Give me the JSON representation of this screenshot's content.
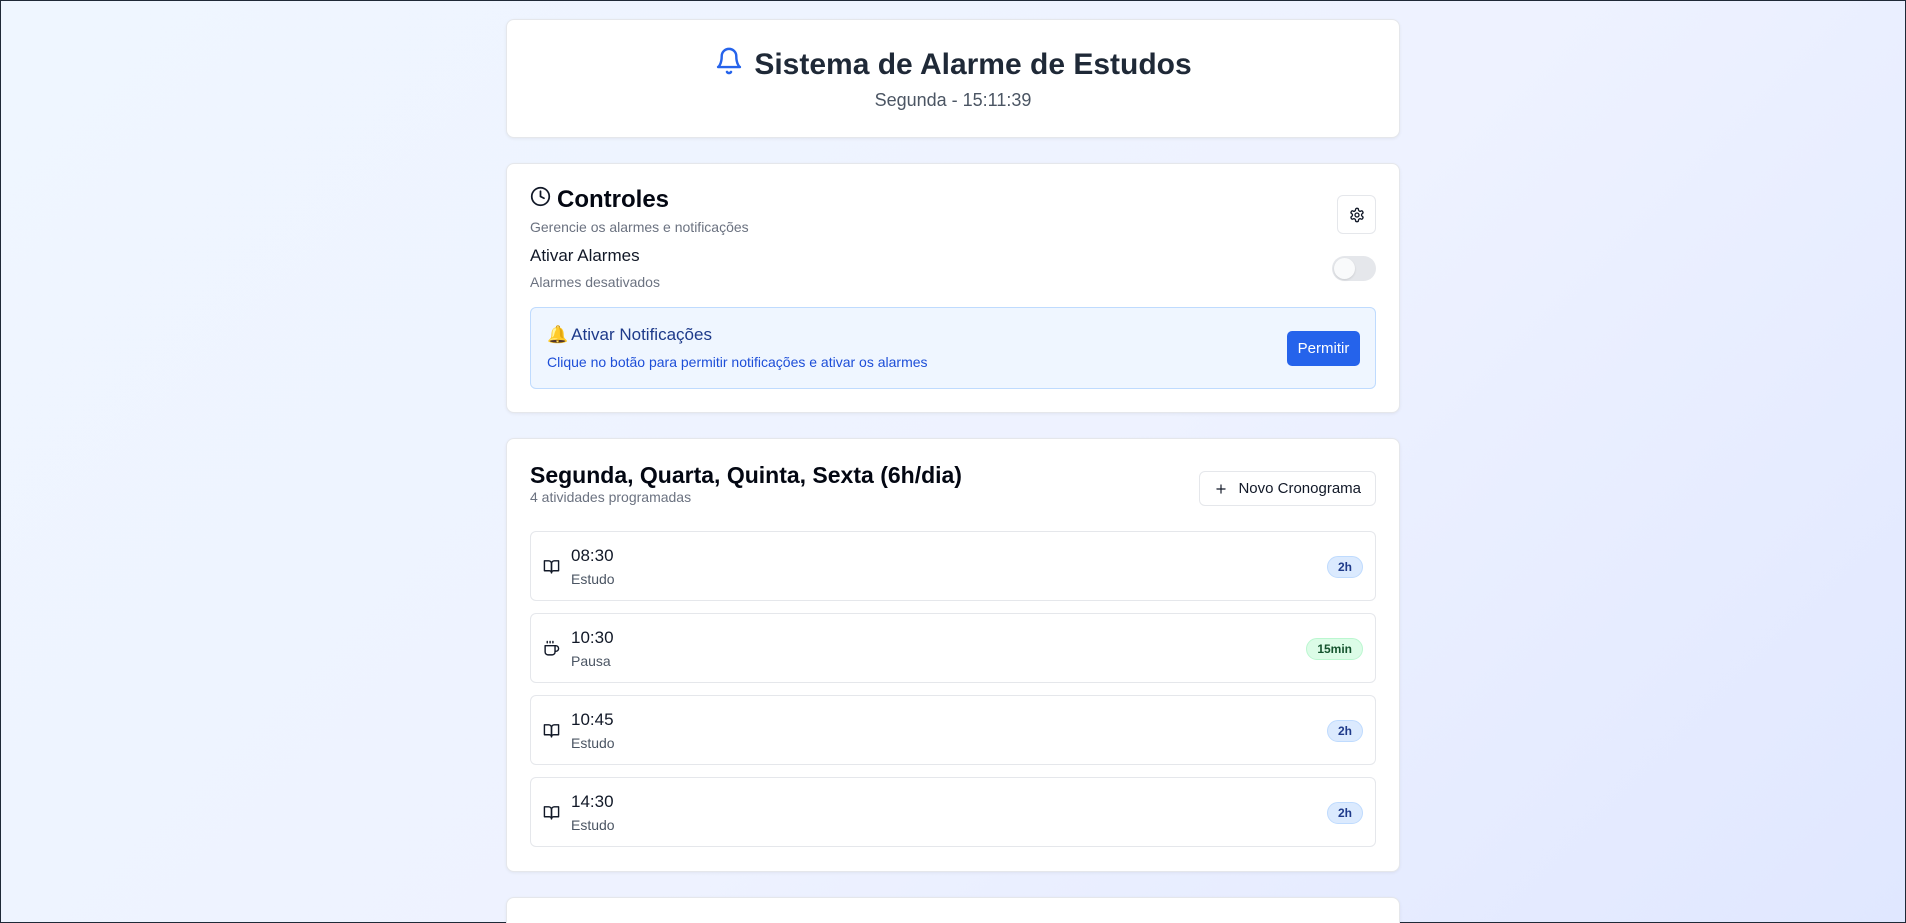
{
  "header": {
    "title": "Sistema de Alarme de Estudos",
    "clock": "Segunda - 15:11:39",
    "icon": "bell-icon",
    "accent_color": "#2563eb"
  },
  "controls": {
    "title": "Controles",
    "subtitle": "Gerencie os alarmes e notificações",
    "settings_icon": "gear-icon",
    "alarm_label": "Ativar Alarmes",
    "alarm_status": "Alarmes desativados",
    "alarm_enabled": false,
    "notifications": {
      "emoji": "🔔",
      "title": "Ativar Notificações",
      "description": "Clique no botão para permitir notificações e ativar os alarmes",
      "button_label": "Permitir"
    }
  },
  "schedule": {
    "title": "Segunda, Quarta, Quinta, Sexta (6h/dia)",
    "count_text": "4 atividades programadas",
    "new_button_label": "Novo Cronograma",
    "activities": [
      {
        "time": "08:30",
        "type": "Estudo",
        "duration": "2h",
        "kind": "study",
        "icon": "book-icon"
      },
      {
        "time": "10:30",
        "type": "Pausa",
        "duration": "15min",
        "kind": "pause",
        "icon": "coffee-icon"
      },
      {
        "time": "10:45",
        "type": "Estudo",
        "duration": "2h",
        "kind": "study",
        "icon": "book-icon"
      },
      {
        "time": "14:30",
        "type": "Estudo",
        "duration": "2h",
        "kind": "study",
        "icon": "book-icon"
      }
    ]
  }
}
